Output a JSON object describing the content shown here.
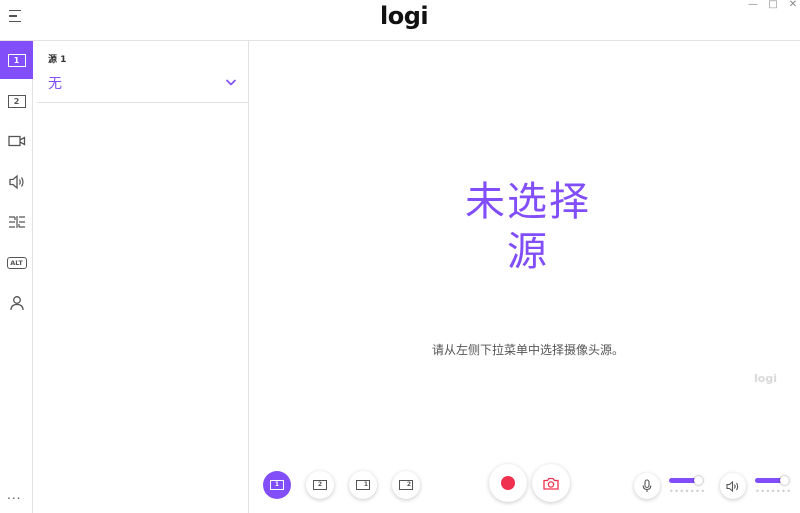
{
  "titlebar": {
    "logo_text": "logi",
    "controls": {
      "minimize": "—",
      "maximize": "□",
      "close": "✕"
    }
  },
  "rail": {
    "items": [
      {
        "name": "source-1",
        "label": "1",
        "active": true
      },
      {
        "name": "source-2",
        "label": "2",
        "active": false
      },
      {
        "name": "camera",
        "icon": "video-camera-icon"
      },
      {
        "name": "audio",
        "icon": "speaker-icon"
      },
      {
        "name": "layout",
        "icon": "layout-split-icon"
      },
      {
        "name": "alt",
        "label": "ALT"
      },
      {
        "name": "account",
        "icon": "user-icon"
      }
    ],
    "more_label": "..."
  },
  "source_panel": {
    "label": "源 1",
    "selected": "无"
  },
  "main": {
    "title_line1": "未选择",
    "title_line2": "源",
    "subtitle": "请从左侧下拉菜单中选择摄像头源。",
    "watermark": "logi"
  },
  "toolbar": {
    "layouts": [
      {
        "name": "layout-1",
        "label": "1",
        "active": true
      },
      {
        "name": "layout-2",
        "label": "2",
        "active": false
      },
      {
        "name": "layout-pip-1",
        "label": "1",
        "active": false
      },
      {
        "name": "layout-pip-2",
        "label": "2",
        "active": false
      }
    ],
    "mic_level": 0.85,
    "speaker_level": 0.85,
    "level_dots": "•••••••"
  },
  "colors": {
    "accent": "#814efa",
    "record": "#f0304f",
    "camera_icon": "#f0304f"
  }
}
